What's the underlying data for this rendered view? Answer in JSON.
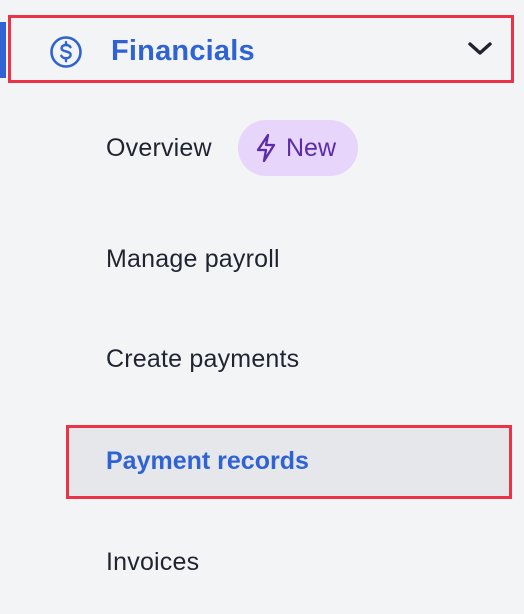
{
  "section": {
    "title": "Financials",
    "icon": "dollar-circle-icon",
    "expand_icon": "chevron-down-icon",
    "accent_color": "#2f63d4",
    "expanded": true
  },
  "items": [
    {
      "label": "Overview",
      "badge": {
        "label": "New",
        "icon": "lightning-bolt-icon"
      }
    },
    {
      "label": "Manage payroll"
    },
    {
      "label": "Create payments"
    },
    {
      "label": "Payment records",
      "active": true
    },
    {
      "label": "Invoices"
    }
  ],
  "colors": {
    "background": "#f3f4f6",
    "text": "#1f2430",
    "badge_background": "#e7d5fb",
    "badge_text": "#5b2ba8",
    "active_background": "#e6e7eb",
    "highlight_border": "#ea3347"
  }
}
